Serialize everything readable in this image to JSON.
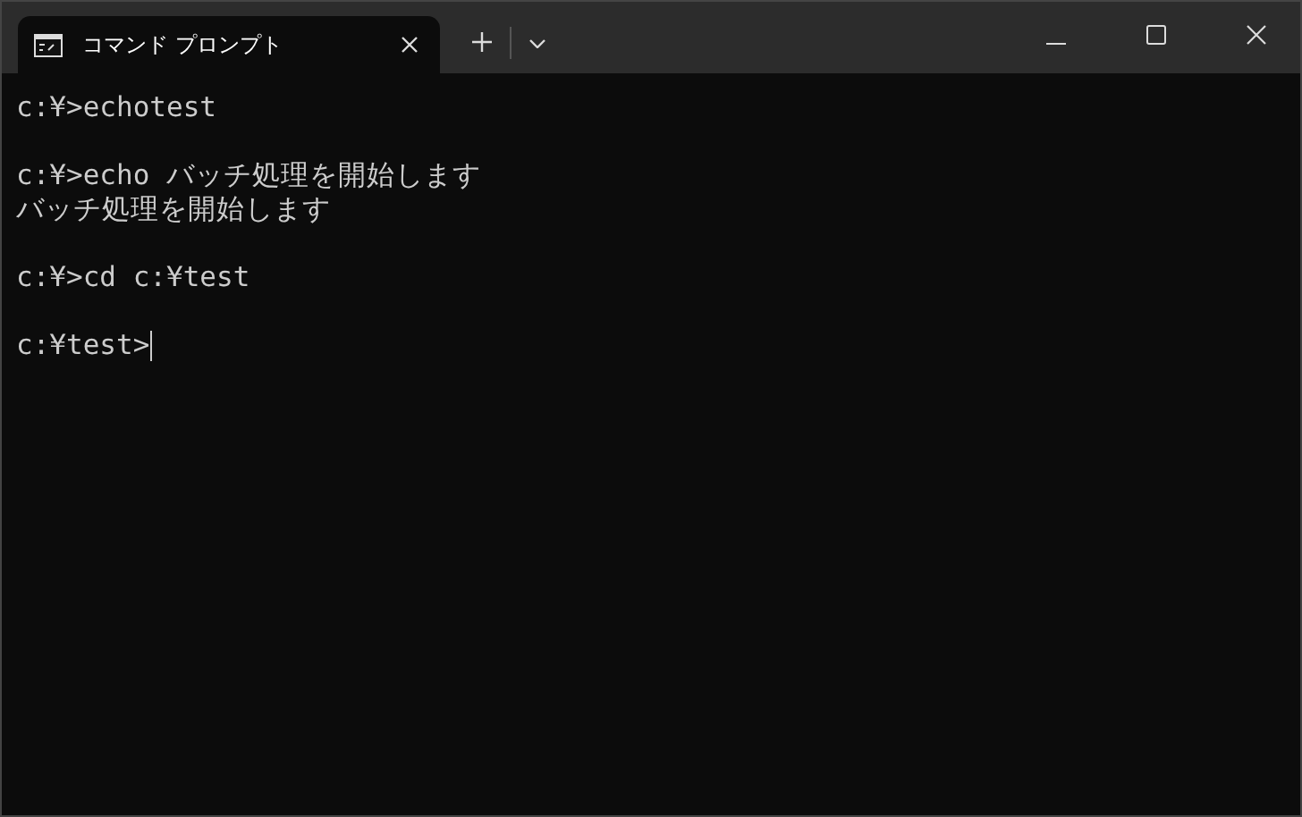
{
  "tabs": [
    {
      "title": "コマンド プロンプト",
      "selected": true
    }
  ],
  "terminal": {
    "blocks": [
      [
        "c:¥>echotest"
      ],
      [
        "c:¥>echo バッチ処理を開始します",
        "バッチ処理を開始します"
      ],
      [
        "c:¥>cd c:¥test"
      ],
      [
        "c:¥test>"
      ]
    ],
    "cursor": true
  }
}
